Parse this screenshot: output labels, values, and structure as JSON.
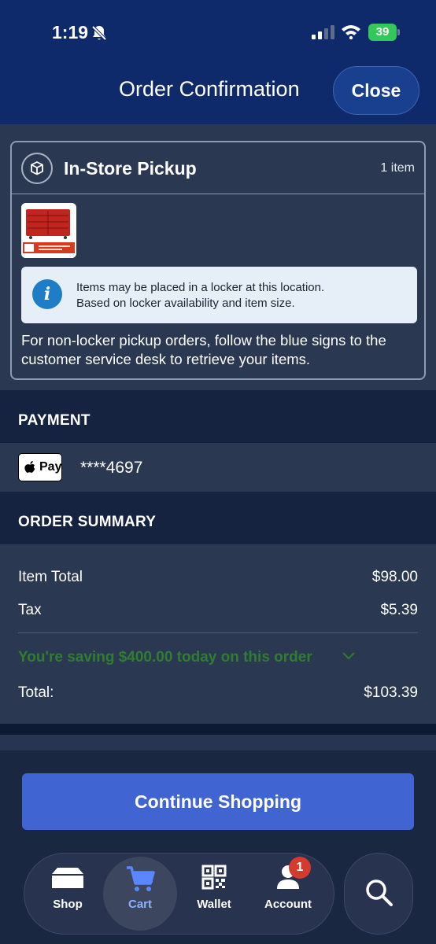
{
  "status_bar": {
    "time": "1:19",
    "battery": "39",
    "icons": [
      "bell-slash-icon",
      "signal-icon",
      "wifi-icon",
      "battery-icon"
    ]
  },
  "header": {
    "title": "Order Confirmation",
    "close_label": "Close"
  },
  "pickup": {
    "title": "In-Store Pickup",
    "count": "1 item",
    "icon": "package-icon",
    "info_line1": "Items may be placed in a locker at this location.",
    "info_line2": "Based on locker availability and item size.",
    "note": "For non-locker pickup orders, follow the blue signs to the customer service desk to retrieve your items."
  },
  "payment": {
    "heading": "PAYMENT",
    "method": "Pay",
    "card": "****4697"
  },
  "summary": {
    "heading": "ORDER SUMMARY",
    "item_total_label": "Item Total",
    "item_total_value": "$98.00",
    "tax_label": "Tax",
    "tax_value": "$5.39",
    "savings": "You're saving $400.00 today on this order",
    "total_label": "Total:",
    "total_value": "$103.39"
  },
  "continue_label": "Continue Shopping",
  "tabs": [
    {
      "label": "Shop",
      "icon": "store-icon"
    },
    {
      "label": "Cart",
      "icon": "cart-icon",
      "active": true
    },
    {
      "label": "Wallet",
      "icon": "qr-code-icon"
    },
    {
      "label": "Account",
      "icon": "person-icon",
      "badge": "1"
    }
  ],
  "colors": {
    "header_bg": "#0f2a6b",
    "body_bg": "#2b3852",
    "section_bar": "#162340",
    "primary_button": "#4064d2",
    "savings_green": "#2f7d2e",
    "badge_red": "#d63a2f"
  }
}
